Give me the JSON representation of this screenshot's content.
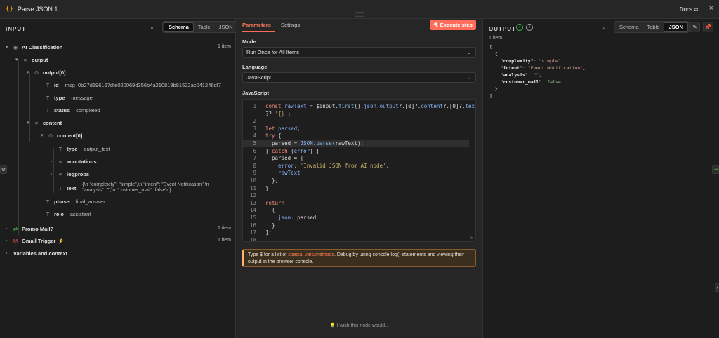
{
  "window": {
    "title_icon": "{}",
    "title": "Parse JSON 1",
    "docs": "Docs"
  },
  "input": {
    "label": "INPUT",
    "view_tabs": [
      "Schema",
      "Table",
      "JSON"
    ],
    "tree": [
      {
        "key": "AI Classification",
        "icon": "globe-icon",
        "count": "1 item"
      },
      {
        "key": "output",
        "icon": "list-icon"
      },
      {
        "key": "output[0]",
        "icon": "object-icon"
      },
      {
        "key": "id",
        "icon": "text-type-icon",
        "value": "msg_0b27d196167dfe020069d356b4a210819b81522ac041246df7"
      },
      {
        "key": "type",
        "icon": "text-type-icon",
        "value": "message"
      },
      {
        "key": "status",
        "icon": "text-type-icon",
        "value": "completed"
      },
      {
        "key": "content",
        "icon": "list-icon"
      },
      {
        "key": "content[0]",
        "icon": "object-icon"
      },
      {
        "key": "type",
        "icon": "text-type-icon",
        "value": "output_text"
      },
      {
        "key": "annotations",
        "icon": "list-icon"
      },
      {
        "key": "logprobs",
        "icon": "list-icon"
      },
      {
        "key": "text",
        "icon": "text-type-icon",
        "value_line1": "{\\n  \"complexity\": \"simple\",\\n  \"intent\": \"Event Notification\",\\n",
        "value_line2": "\"analysis\": \"\",\\n  \"customer_mail\": false\\n}"
      },
      {
        "key": "phase",
        "icon": "text-type-icon",
        "value": "final_answer"
      },
      {
        "key": "role",
        "icon": "text-type-icon",
        "value": "assistant"
      },
      {
        "key": "Promo Mail?",
        "icon": "switch-icon",
        "count": "1 item"
      },
      {
        "key": "Gmail Trigger",
        "icon": "gmail-icon",
        "count": "1 item"
      },
      {
        "key": "Variables and context"
      }
    ]
  },
  "params": {
    "tabs": [
      "Parameters",
      "Settings"
    ],
    "execute_label": "Execute step",
    "mode_label": "Mode",
    "mode_value": "Run Once for All Items",
    "language_label": "Language",
    "language_value": "JavaScript",
    "code_label": "JavaScript",
    "hint_prefix": "Type $ for a list of ",
    "hint_link": "special vars/methods",
    "hint_suffix": ". Debug by using console.log() statements and viewing their output in the browser console.",
    "wish": "I wish this node would..."
  },
  "code_lines": [
    {
      "n": "1",
      "parts": [
        [
          "kw",
          "const "
        ],
        [
          "vr",
          "rawText"
        ],
        [
          "tx",
          " = $input."
        ],
        [
          "fn",
          "first"
        ],
        [
          "tx",
          "()."
        ],
        [
          "vr",
          "json"
        ],
        [
          "tx",
          "."
        ],
        [
          "vr",
          "output"
        ],
        [
          "tx",
          "?.[0]?."
        ],
        [
          "vr",
          "content"
        ],
        [
          "tx",
          "?.[0]?."
        ],
        [
          "vr",
          "text"
        ]
      ]
    },
    {
      "n": "",
      "parts": [
        [
          "tx",
          "?? "
        ],
        [
          "st",
          "'{}'"
        ],
        [
          "tx",
          ";"
        ]
      ]
    },
    {
      "n": "2",
      "parts": []
    },
    {
      "n": "3",
      "parts": [
        [
          "kw",
          "let "
        ],
        [
          "vr",
          "parsed"
        ],
        [
          "tx",
          ";"
        ]
      ]
    },
    {
      "n": "4",
      "parts": [
        [
          "kw",
          "try "
        ],
        [
          "tx",
          "{"
        ]
      ]
    },
    {
      "n": "5",
      "parts": [
        [
          "tx",
          "  parsed = "
        ],
        [
          "vr",
          "JSON"
        ],
        [
          "tx",
          "."
        ],
        [
          "fn",
          "parse"
        ],
        [
          "tx",
          "(rawText);"
        ]
      ]
    },
    {
      "n": "6",
      "parts": [
        [
          "tx",
          "} "
        ],
        [
          "kw",
          "catch "
        ],
        [
          "tx",
          "("
        ],
        [
          "vr",
          "error"
        ],
        [
          "tx",
          ") {"
        ]
      ]
    },
    {
      "n": "7",
      "parts": [
        [
          "tx",
          "  parsed = {"
        ]
      ]
    },
    {
      "n": "8",
      "parts": [
        [
          "vr",
          "    error"
        ],
        [
          "tx",
          ": "
        ],
        [
          "st",
          "'Invalid JSON from AI node'"
        ],
        [
          "tx",
          ","
        ]
      ]
    },
    {
      "n": "9",
      "parts": [
        [
          "vr",
          "    rawText"
        ]
      ]
    },
    {
      "n": "10",
      "parts": [
        [
          "tx",
          "  };"
        ]
      ]
    },
    {
      "n": "11",
      "parts": [
        [
          "tx",
          "}"
        ]
      ]
    },
    {
      "n": "12",
      "parts": []
    },
    {
      "n": "13",
      "parts": [
        [
          "kw",
          "return "
        ],
        [
          "tx",
          "["
        ]
      ]
    },
    {
      "n": "14",
      "parts": [
        [
          "tx",
          "  {"
        ]
      ]
    },
    {
      "n": "15",
      "parts": [
        [
          "vr",
          "    json"
        ],
        [
          "tx",
          ": parsed"
        ]
      ]
    },
    {
      "n": "16",
      "parts": [
        [
          "tx",
          "  }"
        ]
      ]
    },
    {
      "n": "17",
      "parts": [
        [
          "tx",
          "];"
        ]
      ]
    },
    {
      "n": "18",
      "parts": []
    }
  ],
  "output": {
    "label": "OUTPUT",
    "count": "1 item",
    "view_tabs": [
      "Schema",
      "Table",
      "JSON"
    ],
    "json_lines": [
      [
        [
          "tx",
          "["
        ]
      ],
      [
        [
          "tx",
          "  {"
        ]
      ],
      [
        [
          "jk",
          "    \"complexity\""
        ],
        [
          "tx",
          ": "
        ],
        [
          "js",
          "\"simple\""
        ],
        [
          "tx",
          ","
        ]
      ],
      [
        [
          "jk",
          "    \"intent\""
        ],
        [
          "tx",
          ": "
        ],
        [
          "js",
          "\"Event Notification\""
        ],
        [
          "tx",
          ","
        ]
      ],
      [
        [
          "jk",
          "    \"analysis\""
        ],
        [
          "tx",
          ": "
        ],
        [
          "js",
          "\"\""
        ],
        [
          "tx",
          ","
        ]
      ],
      [
        [
          "jk",
          "    \"customer_mail\""
        ],
        [
          "tx",
          ": "
        ],
        [
          "jb",
          "false"
        ]
      ],
      [
        [
          "tx",
          "  }"
        ]
      ],
      [
        [
          "tx",
          "]"
        ]
      ]
    ]
  },
  "colors": {
    "accent": "#ff6d5a",
    "success": "#3fb950",
    "warning": "#ffb36b"
  }
}
